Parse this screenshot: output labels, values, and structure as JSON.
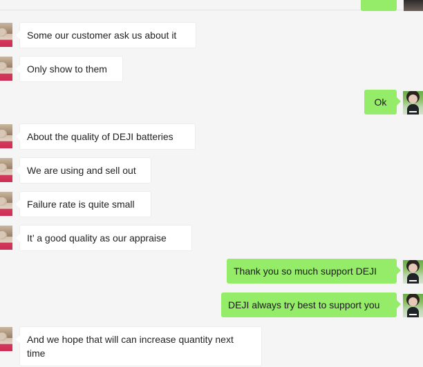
{
  "theme": {
    "background": "#f5f5f5",
    "incoming_bubble": "#ffffff",
    "outgoing_bubble": "#95ec69"
  },
  "messages": [
    {
      "sender": "contact",
      "text": "Some our customer ask us about it"
    },
    {
      "sender": "contact",
      "text": "Only show to them"
    },
    {
      "sender": "me",
      "text": "Ok"
    },
    {
      "sender": "contact",
      "text": "About the quality of DEJI batteries"
    },
    {
      "sender": "contact",
      "text": "We are using and sell out"
    },
    {
      "sender": "contact",
      "text": "Failure rate is quite small"
    },
    {
      "sender": "contact",
      "text": "It’ a good quality as our appraise"
    },
    {
      "sender": "me",
      "text": "Thank you so much support DEJI"
    },
    {
      "sender": "me",
      "text": "DEJI always try best to support you"
    },
    {
      "sender": "contact",
      "text": "And we hope that will can increase quantity next time"
    }
  ]
}
